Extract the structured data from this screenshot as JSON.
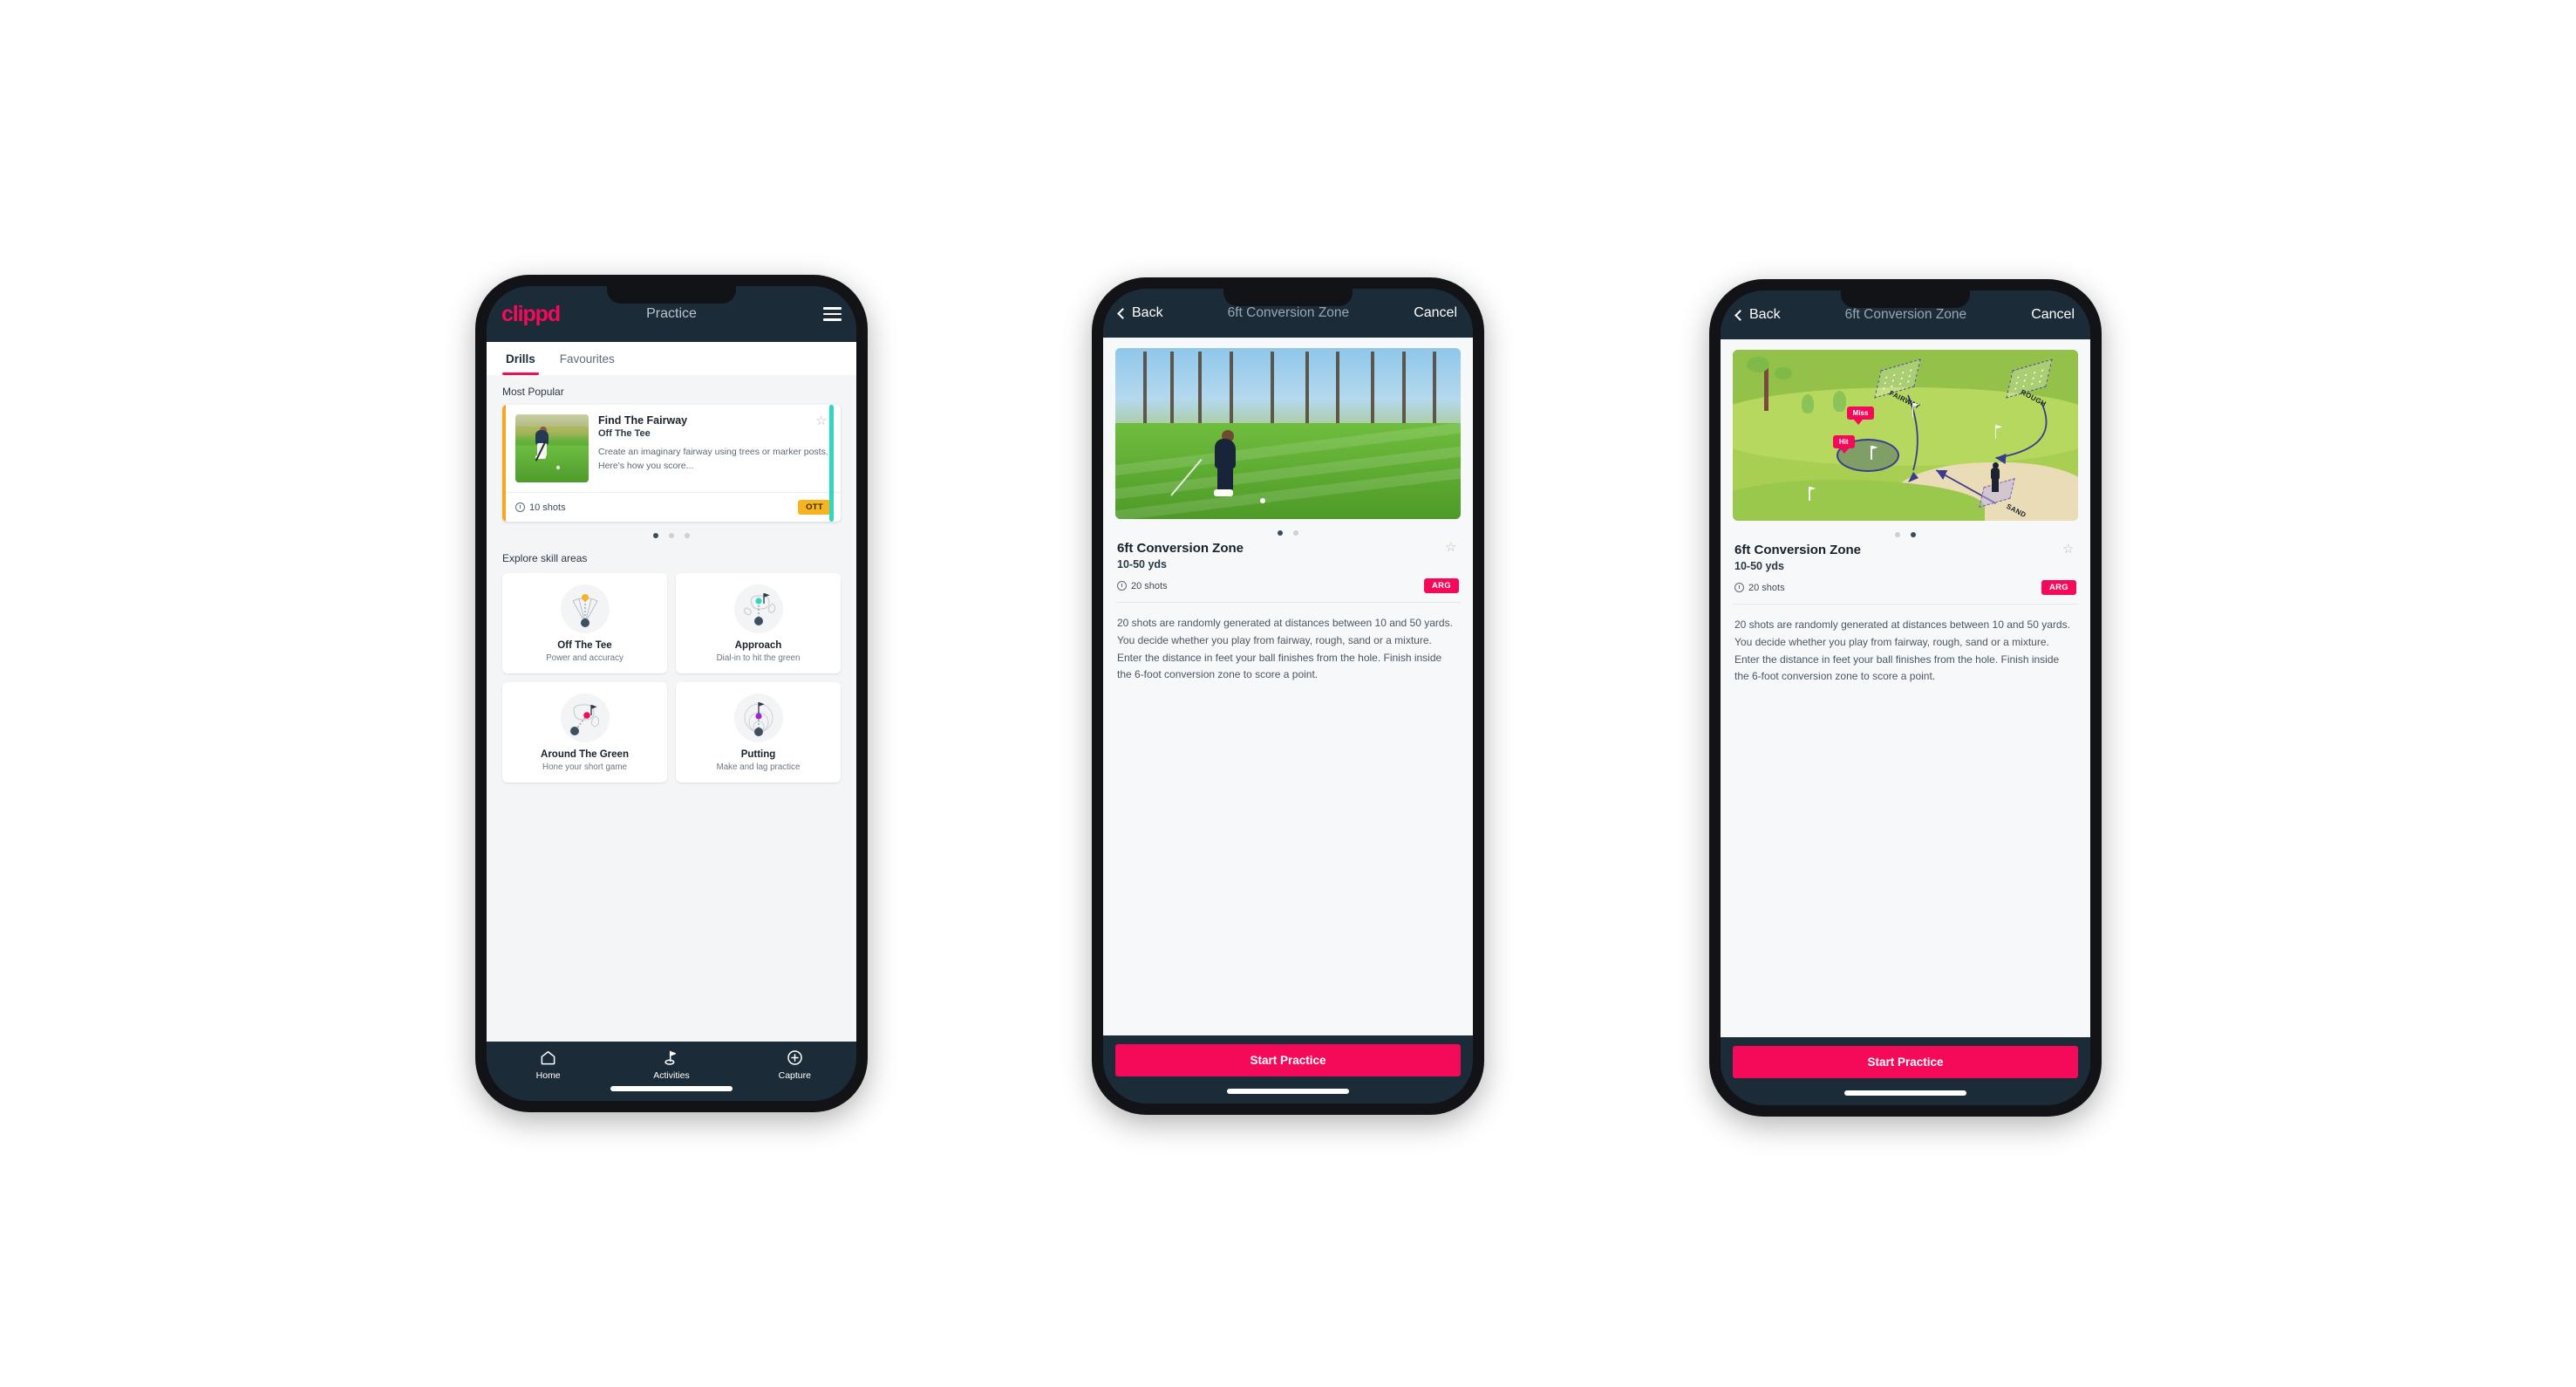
{
  "brand": {
    "logo": "clippd",
    "accent": "#f50a5a",
    "dark": "#1c2b38",
    "amber": "#f5b420",
    "teal": "#2fd6c0"
  },
  "phone1": {
    "header": {
      "logo": "clippd",
      "title": "Practice",
      "menu_icon": "hamburger-icon"
    },
    "tabs": [
      {
        "label": "Drills",
        "active": true
      },
      {
        "label": "Favourites",
        "active": false
      }
    ],
    "most_popular": {
      "section_label": "Most Popular",
      "card": {
        "title": "Find The Fairway",
        "subtitle": "Off The Tee",
        "description": "Create an imaginary fairway using trees or marker posts. Here's how you score...",
        "shots": "10 shots",
        "badge": "OTT",
        "favourite_icon": "star-outline-icon",
        "accent_color": "#f5b420"
      },
      "dots": {
        "count": 3,
        "active": 0
      }
    },
    "explore": {
      "section_label": "Explore skill areas",
      "cards": [
        {
          "name": "Off The Tee",
          "desc": "Power and accuracy",
          "icon": "tee-fan-icon",
          "dot_color": "#f5b420"
        },
        {
          "name": "Approach",
          "desc": "Dial-in to hit the green",
          "icon": "approach-green-icon",
          "dot_color": "#2fd6c0"
        },
        {
          "name": "Around The Green",
          "desc": "Hone your short game",
          "icon": "chip-green-icon",
          "dot_color": "#f50a5a"
        },
        {
          "name": "Putting",
          "desc": "Make and lag practice",
          "icon": "putting-rings-icon",
          "dot_color": "#9b27d6"
        }
      ]
    },
    "tabbar": [
      {
        "label": "Home",
        "icon": "home-icon",
        "active": false
      },
      {
        "label": "Activities",
        "icon": "golf-flag-icon",
        "active": true
      },
      {
        "label": "Capture",
        "icon": "plus-circle-icon",
        "active": false
      }
    ]
  },
  "phone2": {
    "navbar": {
      "back": "Back",
      "title": "6ft Conversion Zone",
      "cancel": "Cancel",
      "back_icon": "chevron-left-icon"
    },
    "hero": {
      "type": "photo",
      "alt": "golfer chipping on fairway with pine trees"
    },
    "dots": {
      "count": 2,
      "active": 0
    },
    "detail": {
      "title": "6ft Conversion Zone",
      "subtitle": "10-50 yds",
      "shots": "20 shots",
      "badge": "ARG",
      "favourite_icon": "star-outline-icon",
      "description": "20 shots are randomly generated at distances between 10 and 50 yards. You decide whether you play from fairway, rough, sand or a mixture. Enter the distance in feet your ball finishes from the hole. Finish inside the 6-foot conversion zone to score a point."
    },
    "cta": "Start Practice"
  },
  "phone3": {
    "navbar": {
      "back": "Back",
      "title": "6ft Conversion Zone",
      "cancel": "Cancel",
      "back_icon": "chevron-left-icon"
    },
    "hero": {
      "type": "illustration",
      "zones": [
        "FAIRWAY",
        "ROUGH",
        "SAND"
      ],
      "markers": [
        "Miss",
        "Hit"
      ]
    },
    "dots": {
      "count": 2,
      "active": 1
    },
    "detail": {
      "title": "6ft Conversion Zone",
      "subtitle": "10-50 yds",
      "shots": "20 shots",
      "badge": "ARG",
      "favourite_icon": "star-outline-icon",
      "description": "20 shots are randomly generated at distances between 10 and 50 yards. You decide whether you play from fairway, rough, sand or a mixture. Enter the distance in feet your ball finishes from the hole. Finish inside the 6-foot conversion zone to score a point."
    },
    "cta": "Start Practice"
  }
}
